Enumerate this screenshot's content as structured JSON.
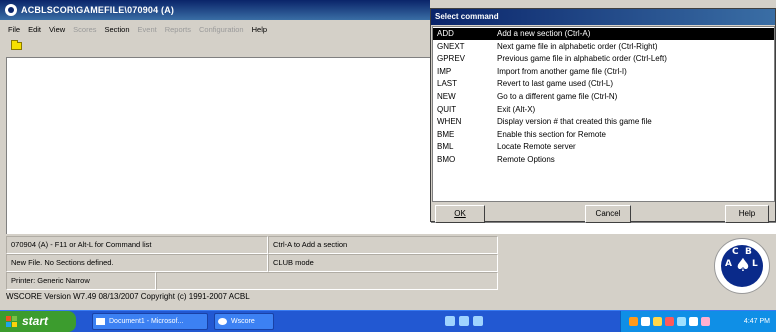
{
  "window": {
    "title": "ACBLSCOR\\GAMEFILE\\070904 (A)"
  },
  "menu": [
    {
      "label": "File",
      "enabled": true
    },
    {
      "label": "Edit",
      "enabled": true
    },
    {
      "label": "View",
      "enabled": true
    },
    {
      "label": "Scores",
      "enabled": false
    },
    {
      "label": "Section",
      "enabled": true
    },
    {
      "label": "Event",
      "enabled": false
    },
    {
      "label": "Reports",
      "enabled": false
    },
    {
      "label": "Configuration",
      "enabled": false
    },
    {
      "label": "Help",
      "enabled": true
    }
  ],
  "dialog": {
    "title": "Select command",
    "commands": [
      {
        "code": "ADD",
        "desc": "Add a new section (Ctrl-A)",
        "selected": true
      },
      {
        "code": "GNEXT",
        "desc": "Next game file in alphabetic order (Ctrl-Right)"
      },
      {
        "code": "GPREV",
        "desc": "Previous game file in alphabetic order (Ctrl-Left)"
      },
      {
        "code": "IMP",
        "desc": "Import from another game file (Ctrl-I)"
      },
      {
        "code": "LAST",
        "desc": "Revert to last game used (Ctrl-L)"
      },
      {
        "code": "NEW",
        "desc": "Go to a different game file (Ctrl-N)"
      },
      {
        "code": "QUIT",
        "desc": "Exit (Alt-X)"
      },
      {
        "code": "WHEN",
        "desc": "Display version # that created this game file"
      },
      {
        "code": "BME",
        "desc": "Enable this section for Remote"
      },
      {
        "code": "BML",
        "desc": "Locate Remote server"
      },
      {
        "code": "BMO",
        "desc": "Remote Options"
      }
    ],
    "ok_label": "OK",
    "cancel_label": "Cancel",
    "help_label": "Help"
  },
  "status": {
    "line1_left": "070904 (A) - F11 or Alt-L for Command list",
    "line1_right": "Ctrl-A to Add a section",
    "line2_left": "New File. No Sections defined.",
    "line2_right": "CLUB mode",
    "line3_left": "Printer: Generic Narrow",
    "version": "WSCORE Version W7.49 08/13/2007  Copyright (c) 1991-2007 ACBL"
  },
  "logo": {
    "letters": [
      "A",
      "C",
      "B",
      "L"
    ],
    "symbol": "♠"
  },
  "taskbar": {
    "start_label": "start",
    "tasks": [
      {
        "label": "Document1 - Microsof..."
      },
      {
        "label": "Wscore"
      }
    ],
    "clock": "4:47 PM"
  },
  "colors": {
    "title_bar": "#0a246a",
    "taskbar": "#2258d2",
    "start_button": "#3c9c2e",
    "selection": "#000000",
    "logo_blue": "#0a2a8a"
  }
}
